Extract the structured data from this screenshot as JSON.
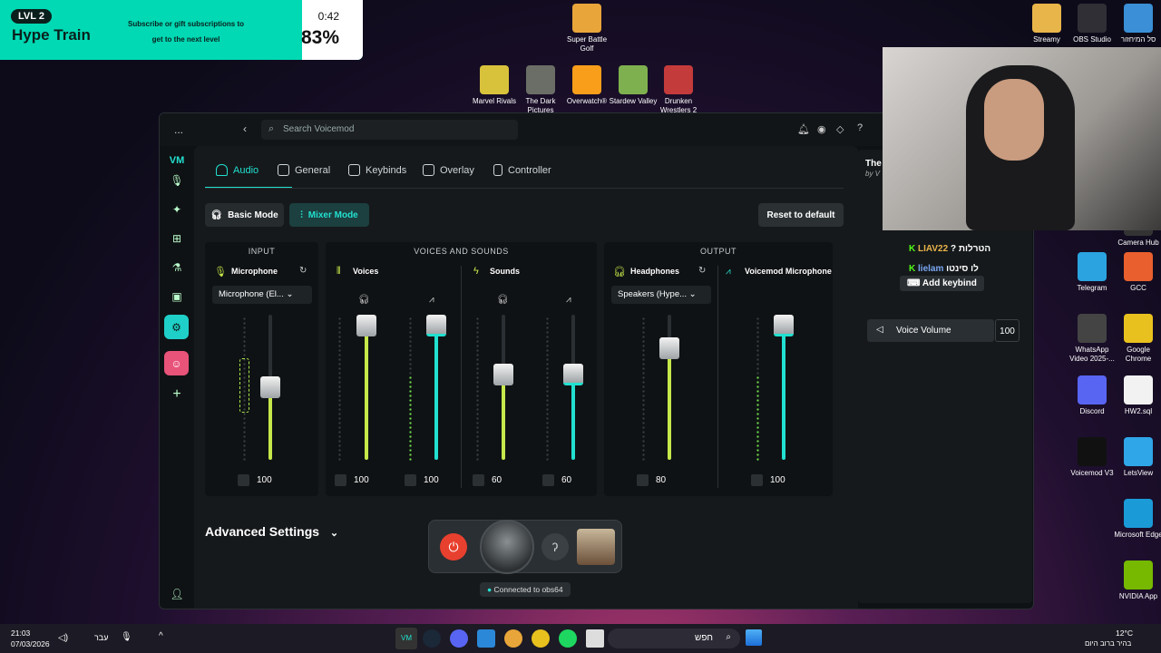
{
  "hype": {
    "level": "LVL 2",
    "title": "Hype Train",
    "message": "Subscribe or gift subscriptions to get to the next level",
    "time": "0:42",
    "percent": "83%"
  },
  "desktop": [
    {
      "label": "Super Battle Golf",
      "color": "#e8a53a"
    },
    {
      "label": "Marvel Rivals",
      "color": "#d9c23b"
    },
    {
      "label": "The Dark Pictures",
      "color": "#6b6e66"
    },
    {
      "label": "Overwatch®",
      "color": "#f99e1a"
    },
    {
      "label": "Stardew Valley",
      "color": "#7fb04f"
    },
    {
      "label": "Drunken Wrestlers 2",
      "color": "#c43b3b"
    },
    {
      "label": "Streamy",
      "color": "#e8b54a"
    },
    {
      "label": "OBS Studio",
      "color": "#2f2f35"
    },
    {
      "label": "סל המיחזור",
      "color": "#3a8fd6"
    },
    {
      "label": "Camera Hub",
      "color": "#333"
    },
    {
      "label": "Telegram",
      "color": "#2aa3e0"
    },
    {
      "label": "GCC",
      "color": "#e9602e"
    },
    {
      "label": "WhatsApp Video 2025-...",
      "color": "#444"
    },
    {
      "label": "Google Chrome",
      "color": "#e9c11e"
    },
    {
      "label": "Discord",
      "color": "#5865f2"
    },
    {
      "label": "HW2.sql",
      "color": "#f2f2f2"
    },
    {
      "label": "Voicemod V3",
      "color": "#111"
    },
    {
      "label": "LetsView",
      "color": "#2fa6e8"
    },
    {
      "label": "Microsoft Edge",
      "color": "#1a9bd7"
    },
    {
      "label": "NVIDIA App",
      "color": "#76b900"
    }
  ],
  "app": {
    "menu": "...",
    "search_placeholder": "Search Voicemod",
    "tabs": [
      "Audio",
      "General",
      "Keybinds",
      "Overlay",
      "Controller"
    ],
    "basic_mode": "Basic Mode",
    "mixer_mode": "Mixer Mode",
    "reset": "Reset to default",
    "sections": {
      "input": "INPUT",
      "voices_sounds": "VOICES AND SOUNDS",
      "output": "OUTPUT"
    },
    "channels": {
      "microphone": "Microphone",
      "mic_device": "Microphone (El...",
      "voices": "Voices",
      "sounds": "Sounds",
      "headphones": "Headphones",
      "headphones_device": "Speakers (Hype...",
      "vm_mic": "Voicemod Microphone"
    },
    "volumes": {
      "mic": "100",
      "voices_hp": "100",
      "voices_vm": "100",
      "sounds_hp": "60",
      "sounds_vm": "60",
      "headphones": "80",
      "vm_mic": "100"
    },
    "advanced": "Advanced Settings",
    "connected": "Connected to obs64",
    "right_title": "The",
    "right_sub": "by V",
    "add_keybind": "Add keybind",
    "voice_volume_label": "Voice Volume",
    "voice_volume": "100"
  },
  "chat": [
    {
      "user": "LIAV22",
      "text": "? הטרלות"
    },
    {
      "user": "lielam",
      "text": "לו סינטו"
    }
  ],
  "taskbar": {
    "time": "21:03",
    "date": "07/03/2026",
    "lang": "עבר",
    "search": "חפש",
    "weather_temp": "12°C",
    "weather_text": "בהיר ברוב היום"
  }
}
